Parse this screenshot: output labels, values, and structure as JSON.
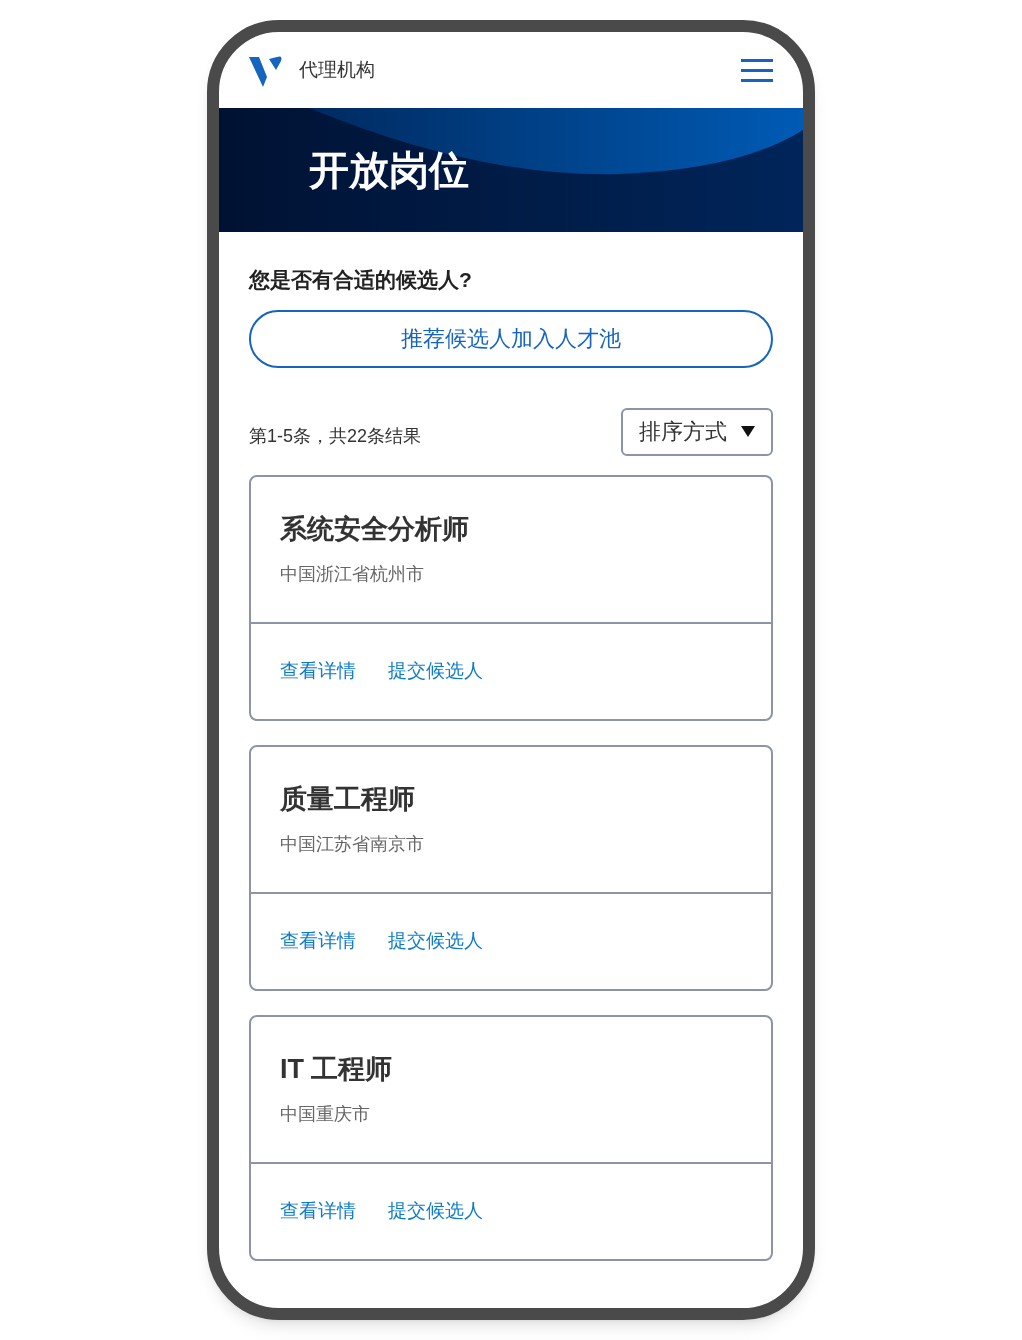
{
  "header": {
    "brand": "代理机构"
  },
  "banner": {
    "title": "开放岗位"
  },
  "prompt": "您是否有合适的候选人?",
  "refer_button": "推荐候选人加入人才池",
  "results": {
    "summary": "第1-5条，共22条结果",
    "sort_label": "排序方式"
  },
  "jobs": [
    {
      "title": "系统安全分析师",
      "location": "中国浙江省杭州市",
      "actions": [
        "查看详情",
        "提交候选人"
      ]
    },
    {
      "title": "质量工程师",
      "location": "中国江苏省南京市",
      "actions": [
        "查看详情",
        "提交候选人"
      ]
    },
    {
      "title": "IT 工程师",
      "location": "中国重庆市",
      "actions": [
        "查看详情",
        "提交候选人"
      ]
    }
  ]
}
